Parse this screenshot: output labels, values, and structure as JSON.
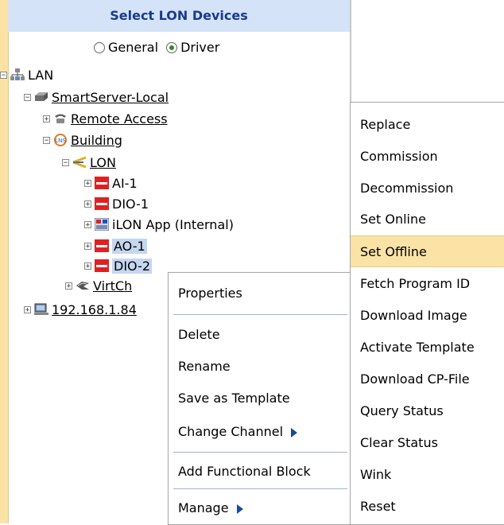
{
  "header": {
    "title": "Select LON Devices"
  },
  "view_options": {
    "general": "General",
    "driver": "Driver",
    "selected": "Driver"
  },
  "tree": {
    "lan": "LAN",
    "smartserver": "SmartServer-Local",
    "remote_access": "Remote Access",
    "building": "Building",
    "lon": "LON",
    "ai1": "AI-1",
    "dio1": "DIO-1",
    "ilon_app": "iLON App (Internal)",
    "ao1": "AO-1",
    "dio2": "DIO-2",
    "virtch": "VirtCh",
    "ip": "192.168.1.84"
  },
  "context_menu": {
    "properties": "Properties",
    "delete": "Delete",
    "rename": "Rename",
    "save_as_template": "Save as Template",
    "change_channel": "Change Channel",
    "add_functional_block": "Add Functional Block",
    "manage": "Manage"
  },
  "submenu": {
    "replace": "Replace",
    "commission": "Commission",
    "decommission": "Decommission",
    "set_online": "Set Online",
    "set_offline": "Set Offline",
    "fetch_program_id": "Fetch Program ID",
    "download_image": "Download Image",
    "activate_template": "Activate Template",
    "download_cp_file": "Download CP-File",
    "query_status": "Query Status",
    "clear_status": "Clear Status",
    "wink": "Wink",
    "reset": "Reset"
  },
  "colors": {
    "header_bg": "#d4e3f7",
    "accent": "#fbe3a6",
    "selection": "#c5d6ef",
    "device_red": "#e02020"
  }
}
